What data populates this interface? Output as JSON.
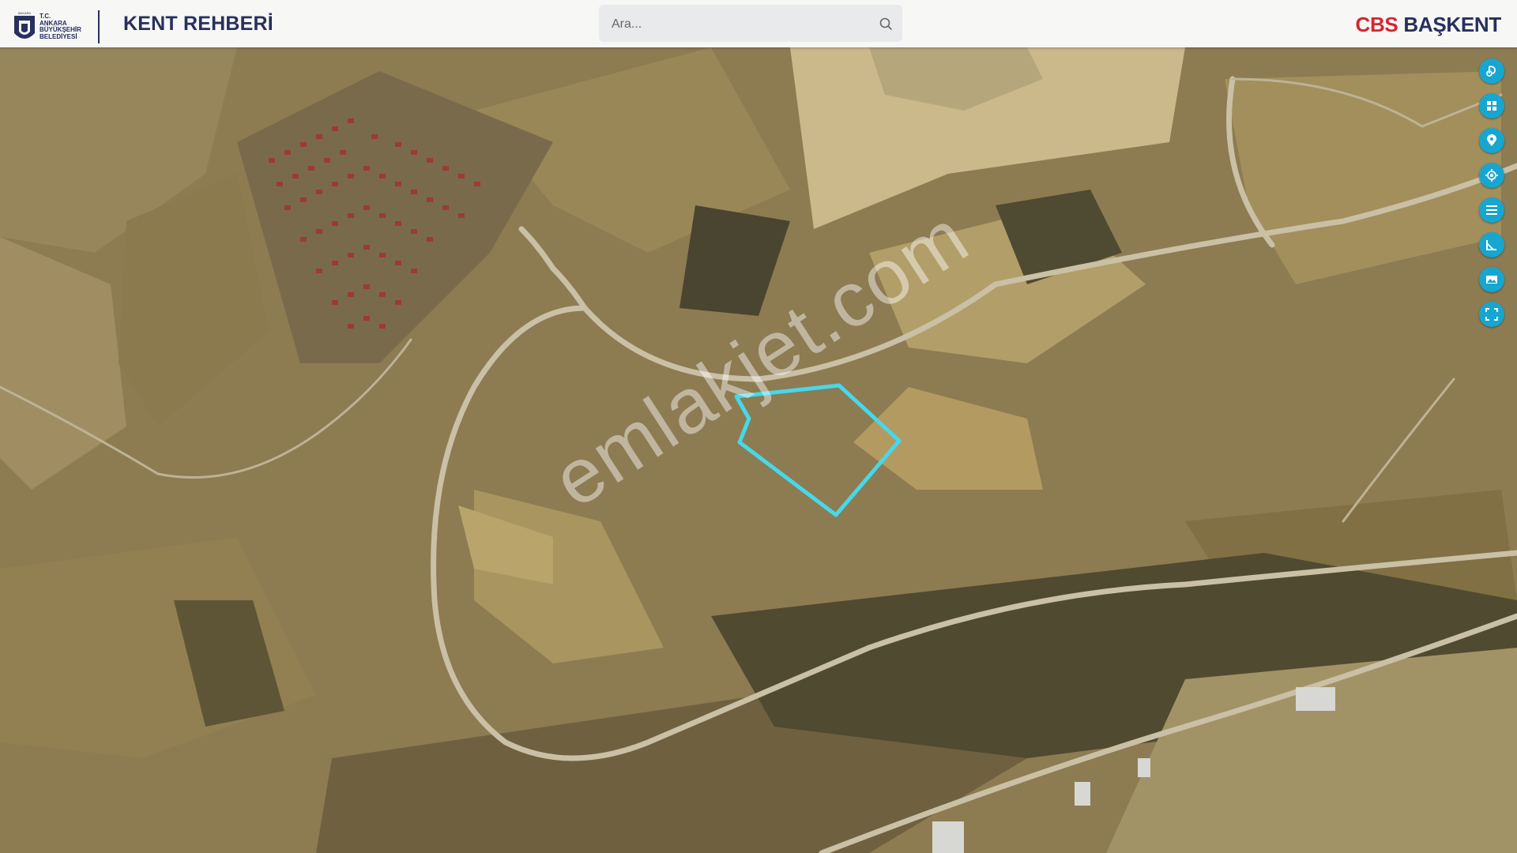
{
  "header": {
    "logo": {
      "lines": [
        "T.C.",
        "ANKARA",
        "BÜYÜKŞEHİR",
        "BELEDİYESİ"
      ],
      "arc_text": "ANKARA"
    },
    "app_title": "KENT REHBERİ",
    "brand": {
      "part1": "CBS",
      "part2": "BAŞKENT"
    }
  },
  "search": {
    "placeholder": "Ara..."
  },
  "map": {
    "watermark": "emlakjet.com",
    "parcel_outline_color": "#46d8ea"
  },
  "toolbar": {
    "items": [
      {
        "icon": "bicycle-route-icon"
      },
      {
        "icon": "layers-grid-icon"
      },
      {
        "icon": "location-pin-icon"
      },
      {
        "icon": "gps-locate-icon"
      },
      {
        "icon": "menu-list-icon"
      },
      {
        "icon": "measure-icon"
      },
      {
        "icon": "image-gallery-icon"
      },
      {
        "icon": "fullscreen-icon"
      }
    ],
    "accent_color": "#17a6cf"
  }
}
